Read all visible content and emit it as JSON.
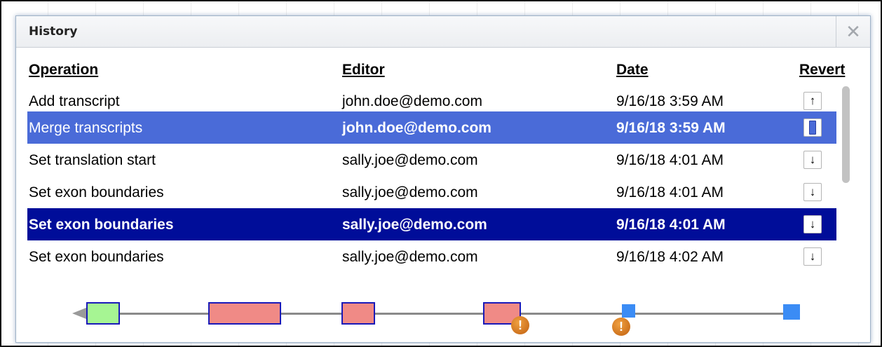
{
  "dialog": {
    "title": "History",
    "close_glyph": "✕"
  },
  "table": {
    "headers": {
      "operation": "Operation",
      "editor": "Editor",
      "date": "Date",
      "revert": "Revert"
    },
    "rows": [
      {
        "operation": "Add transcript",
        "editor": "john.doe@demo.com",
        "date": "9/16/18 3:59 AM",
        "revert_glyph": "↑",
        "state": "normal"
      },
      {
        "operation": "Merge transcripts",
        "editor": "john.doe@demo.com",
        "date": "9/16/18 3:59 AM",
        "revert_glyph": "",
        "state": "current"
      },
      {
        "operation": "Set translation start",
        "editor": "sally.joe@demo.com",
        "date": "9/16/18 4:01 AM",
        "revert_glyph": "↓",
        "state": "normal"
      },
      {
        "operation": "Set exon boundaries",
        "editor": "sally.joe@demo.com",
        "date": "9/16/18 4:01 AM",
        "revert_glyph": "↓",
        "state": "normal"
      },
      {
        "operation": "Set exon boundaries",
        "editor": "sally.joe@demo.com",
        "date": "9/16/18 4:01 AM",
        "revert_glyph": "↓",
        "state": "selected"
      },
      {
        "operation": "Set exon boundaries",
        "editor": "sally.joe@demo.com",
        "date": "9/16/18 4:02 AM",
        "revert_glyph": "↓",
        "state": "normal"
      }
    ]
  },
  "preview": {
    "warning_glyph": "!",
    "colors": {
      "utr": "#a6f593",
      "cds": "#f08a86",
      "exon_border": "#1a1ab8",
      "small_exon": "#3b8cf5",
      "warning": "#d07520",
      "current_row": "#4a6bd8",
      "selected_row": "#000d99"
    }
  }
}
